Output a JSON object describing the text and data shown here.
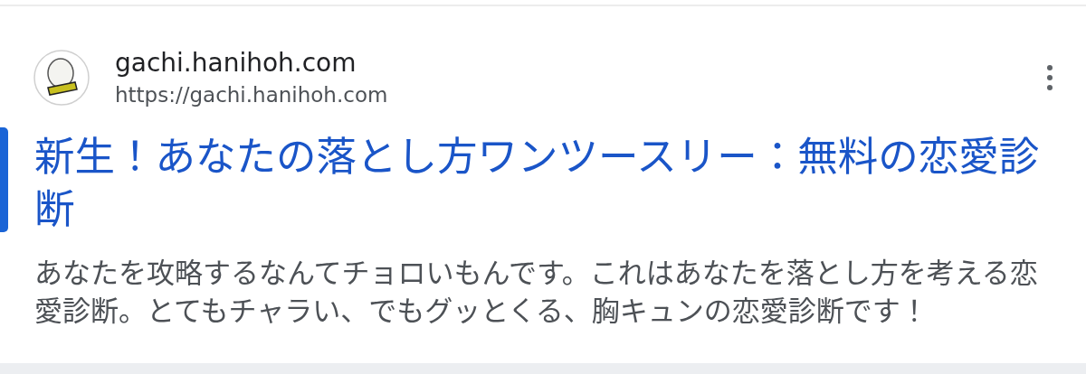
{
  "result": {
    "site_name": "gachi.hanihoh.com",
    "url": "https://gachi.hanihoh.com",
    "title": "新生！あなたの落とし方ワンツースリー：無料の恋愛診断",
    "snippet": "あなたを攻略するなんてチョロいもんです。これはあなたを落とし方を考える恋愛診断。とてもチャラい、でもグッとくる、胸キュンの恋愛診断です！",
    "focused": true
  }
}
